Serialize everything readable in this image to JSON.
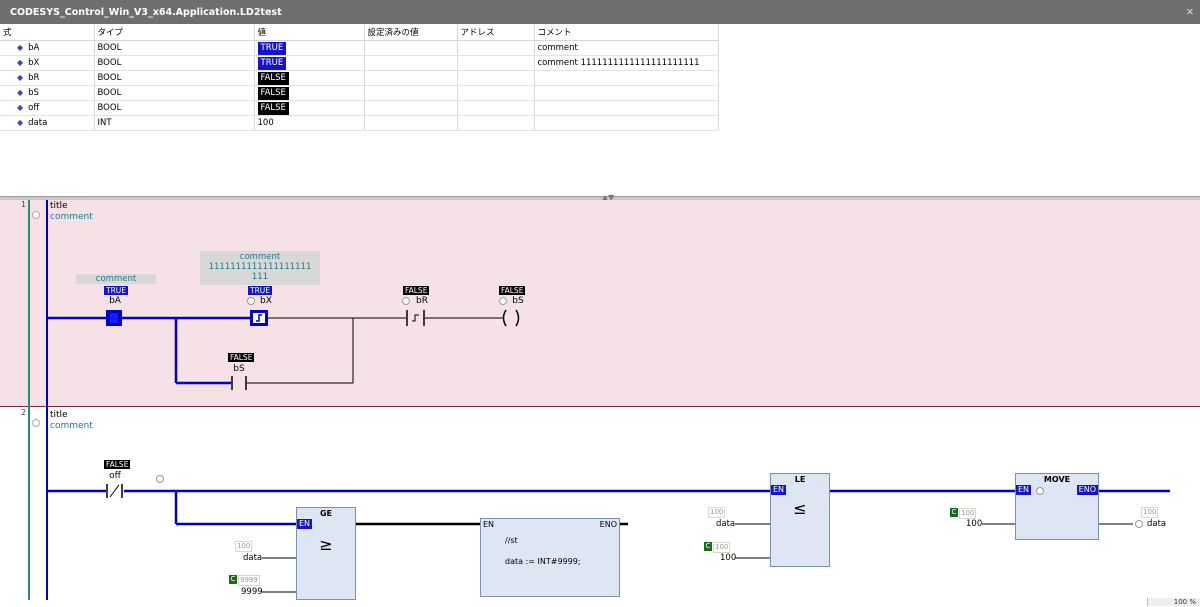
{
  "window": {
    "title": "CODESYS_Control_Win_V3_x64.Application.LD2test"
  },
  "var_table": {
    "headers": [
      "式",
      "タイプ",
      "値",
      "設定済みの値",
      "アドレス",
      "コメント"
    ],
    "rows": [
      {
        "name": "bA",
        "type": "BOOL",
        "value": "TRUE",
        "prepared": "",
        "address": "",
        "comment": "comment"
      },
      {
        "name": "bX",
        "type": "BOOL",
        "value": "TRUE",
        "prepared": "",
        "address": "",
        "comment": "comment 1111111111111111111111"
      },
      {
        "name": "bR",
        "type": "BOOL",
        "value": "FALSE",
        "prepared": "",
        "address": "",
        "comment": ""
      },
      {
        "name": "bS",
        "type": "BOOL",
        "value": "FALSE",
        "prepared": "",
        "address": "",
        "comment": ""
      },
      {
        "name": "off",
        "type": "BOOL",
        "value": "FALSE",
        "prepared": "",
        "address": "",
        "comment": ""
      },
      {
        "name": "data",
        "type": "INT",
        "value": "100",
        "prepared": "",
        "address": "",
        "comment": ""
      }
    ]
  },
  "rung1": {
    "number": "1",
    "title": "title",
    "comment": "comment",
    "bA": {
      "comment": "comment",
      "value": "TRUE",
      "name": "bA"
    },
    "bX": {
      "comment_line1": "comment",
      "comment_line2": "1111111111111111111",
      "comment_line3": "111",
      "value": "TRUE",
      "name": "bX"
    },
    "bR": {
      "value": "FALSE",
      "name": "bR"
    },
    "bS_coil": {
      "value": "FALSE",
      "name": "bS"
    },
    "bS_branch": {
      "value": "FALSE",
      "name": "bS"
    }
  },
  "rung2": {
    "number": "2",
    "title": "title",
    "comment": "comment",
    "off": {
      "value": "FALSE",
      "name": "off"
    },
    "ge": {
      "name": "GE",
      "en": "EN",
      "symbol": "≥",
      "in1_val": "100",
      "in1": "data",
      "const_tag": "C",
      "in2_val": "9999",
      "in2": "9999"
    },
    "st": {
      "en": "EN",
      "eno": "ENO",
      "line1": "//st",
      "line2": "data := INT#9999;"
    },
    "le": {
      "name": "LE",
      "en": "EN",
      "symbol": "≤",
      "in1_val": "100",
      "in1": "data",
      "const_tag": "C",
      "in2_val": "100",
      "in2": "100"
    },
    "move": {
      "name": "MOVE",
      "en": "EN",
      "eno": "ENO",
      "const_tag": "C",
      "in_val": "100",
      "in": "100",
      "out_val": "100",
      "out": "data"
    }
  },
  "status": {
    "zoom": "100 %"
  },
  "colors": {
    "true_bg": "#1414c8",
    "false_bg": "#000000",
    "power_flow": "#0000c8",
    "rung_highlight": "#f5e1e6",
    "gutter": "#2a8a73"
  }
}
